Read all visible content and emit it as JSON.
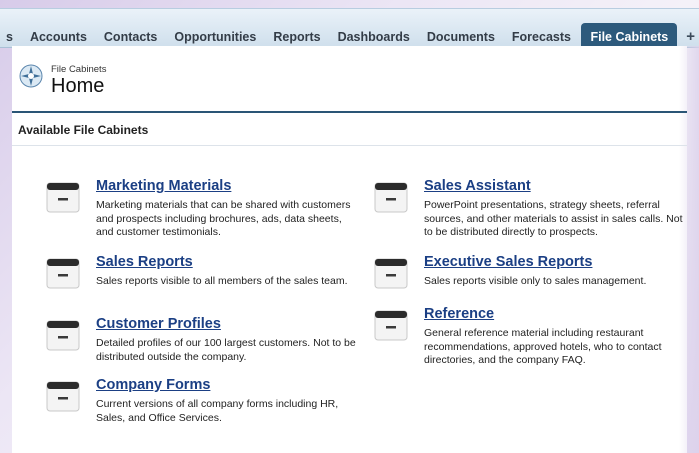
{
  "nav": {
    "tabs": [
      {
        "label": "s"
      },
      {
        "label": "Accounts"
      },
      {
        "label": "Contacts"
      },
      {
        "label": "Opportunities"
      },
      {
        "label": "Reports"
      },
      {
        "label": "Dashboards"
      },
      {
        "label": "Documents"
      },
      {
        "label": "Forecasts"
      },
      {
        "label": "File Cabinets",
        "active": true
      },
      {
        "label": "+"
      }
    ]
  },
  "header": {
    "subtitle": "File Cabinets",
    "title": "Home"
  },
  "section": {
    "title": "Available File Cabinets"
  },
  "cabinets": [
    {
      "name": "Marketing Materials",
      "description": "Marketing materials that can be shared with customers and prospects including brochures, ads, data sheets, and customer testimonials."
    },
    {
      "name": "Sales Reports",
      "description": "Sales reports visible to all members of the sales team."
    },
    {
      "name": "Customer Profiles",
      "description": "Detailed profiles of our 100 largest customers. Not to be distributed outside the company."
    },
    {
      "name": "Company Forms",
      "description": "Current versions of all company forms including HR, Sales, and Office Services."
    },
    {
      "name": "Sales Assistant",
      "description": "PowerPoint presentations, strategy sheets, referral sources, and other materials to assist in sales calls. Not to be distributed directly to prospects."
    },
    {
      "name": "Executive Sales Reports",
      "description": "Sales reports visible only to sales management."
    },
    {
      "name": "Reference",
      "description": "General reference material including restaurant recommendations, approved hotels, who to contact directories, and the company FAQ."
    }
  ],
  "colors": {
    "active_tab": "#2d5a7c",
    "link": "#1b3f84",
    "header_rule": "#2a5576"
  }
}
